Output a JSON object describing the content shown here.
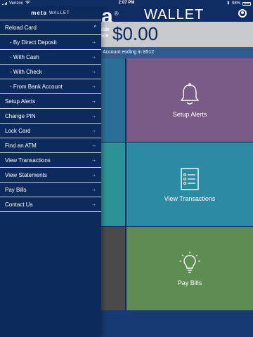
{
  "status_bar": {
    "carrier": "Verizon",
    "time": "2:07 PM",
    "battery": "98%"
  },
  "header": {
    "brand": "meta",
    "wallet": "WALLET",
    "brand_partial": "ta"
  },
  "balance": {
    "label_line1": "able",
    "label_line2": "nce",
    "amount": "$0.00"
  },
  "account": {
    "text": "Account ending in 8512"
  },
  "tiles": {
    "setup_alerts": "Setup Alerts",
    "view_transactions": "View Transactions",
    "pay_bills": "Pay Bills"
  },
  "drawer": {
    "brand": "meta",
    "wallet": "WALLET",
    "items": [
      {
        "label": "Reload Card",
        "arrow": "^"
      },
      {
        "label": "- By Direct Deposit",
        "arrow": "→"
      },
      {
        "label": "- With Cash",
        "arrow": "→"
      },
      {
        "label": "- With Check",
        "arrow": "→"
      },
      {
        "label": "- From Bank Account",
        "arrow": "→"
      },
      {
        "label": "Setup Alerts",
        "arrow": "→"
      },
      {
        "label": "Change PIN",
        "arrow": "→"
      },
      {
        "label": "Lock Card",
        "arrow": "→"
      },
      {
        "label": "Find an ATM",
        "arrow": "→"
      },
      {
        "label": "View Transactions",
        "arrow": "→"
      },
      {
        "label": "View Statements",
        "arrow": "→"
      },
      {
        "label": "Pay Bills",
        "arrow": "→"
      },
      {
        "label": "Contact Us",
        "arrow": "→"
      }
    ]
  },
  "colors": {
    "navy": "#0d2a5c",
    "teal": "#2c8aa3",
    "purple": "#7a5a86",
    "green": "#5f8c53",
    "gray": "#4a4a4a"
  }
}
